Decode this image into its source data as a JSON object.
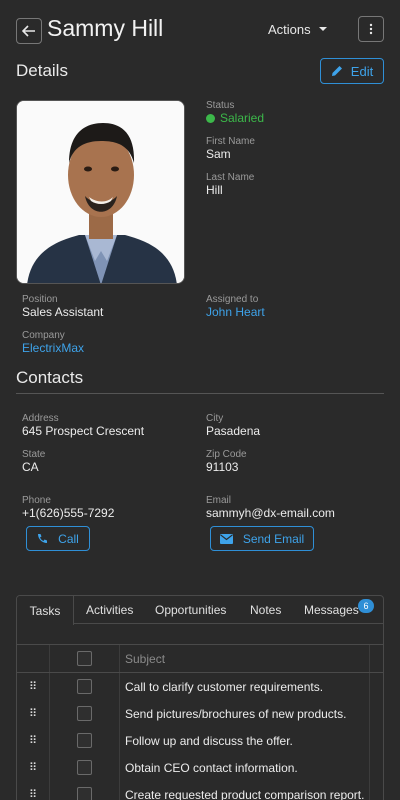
{
  "header": {
    "title": "Sammy Hill",
    "actions_label": "Actions"
  },
  "details": {
    "section_title": "Details",
    "edit_label": "Edit",
    "status": {
      "label": "Status",
      "value": "Salaried",
      "color": "#3cb84a"
    },
    "first_name": {
      "label": "First Name",
      "value": "Sam"
    },
    "last_name": {
      "label": "Last Name",
      "value": "Hill"
    },
    "position": {
      "label": "Position",
      "value": "Sales Assistant"
    },
    "assigned_to": {
      "label": "Assigned to",
      "value": "John Heart"
    },
    "company": {
      "label": "Company",
      "value": "ElectrixMax"
    }
  },
  "contacts": {
    "section_title": "Contacts",
    "address": {
      "label": "Address",
      "value": "645 Prospect Crescent"
    },
    "city": {
      "label": "City",
      "value": "Pasadena"
    },
    "state": {
      "label": "State",
      "value": "CA"
    },
    "zip": {
      "label": "Zip Code",
      "value": "91103"
    },
    "phone": {
      "label": "Phone",
      "value": "+1(626)555-7292"
    },
    "email": {
      "label": "Email",
      "value": "sammyh@dx-email.com"
    },
    "call_label": "Call",
    "send_email_label": "Send Email"
  },
  "tabs": {
    "items": [
      "Tasks",
      "Activities",
      "Opportunities",
      "Notes",
      "Messages"
    ],
    "active": "Tasks",
    "messages_badge": "6"
  },
  "tasks": {
    "column_subject": "Subject",
    "rows": [
      "Call to clarify customer requirements.",
      "Send pictures/brochures of new products.",
      "Follow up and discuss the offer.",
      "Obtain CEO contact information.",
      "Create requested product comparison report."
    ]
  },
  "colors": {
    "accent": "#2f8fd6",
    "background": "#2a2a2a",
    "status_green": "#3cb84a"
  }
}
